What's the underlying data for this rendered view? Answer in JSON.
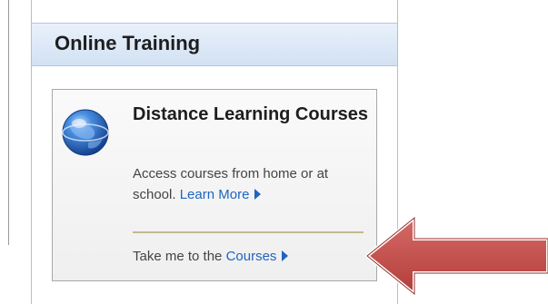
{
  "sidebar": {
    "title": "Online Training"
  },
  "card": {
    "title": "Distance Learning Courses",
    "description": "Access courses from home or at school.",
    "learn_more_label": "Learn More",
    "courses_prefix": "Take me to the",
    "courses_link_label": "Courses"
  },
  "icons": {
    "globe": "globe-icon",
    "link_arrow": "triangle-right-icon",
    "pointer_arrow": "red-left-arrow-icon"
  },
  "colors": {
    "header_bg": "#d2e1f3",
    "link": "#1f64c0",
    "divider": "#c6b88e",
    "annotation_arrow": "#c0504d"
  }
}
